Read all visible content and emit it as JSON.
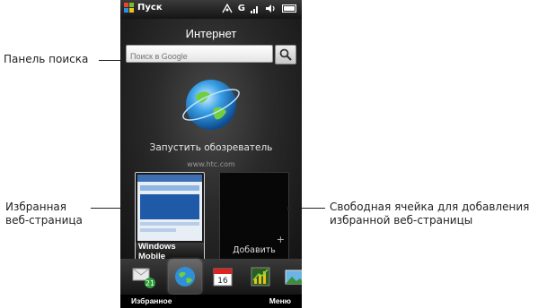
{
  "status_bar": {
    "start_label": "Пуск",
    "network": "G",
    "signal_icon": "signal-icon",
    "sound_icon": "speaker-icon",
    "battery_icon": "battery-icon"
  },
  "internet_tab": {
    "title": "Интернет",
    "search_placeholder": "Поиск в Google",
    "launch_browser_label": "Запустить обозреватель",
    "home_url": "www.htc.com",
    "favorite_tile": {
      "label": "Windows Mobile"
    },
    "empty_tile": {
      "label": "Добавить",
      "plus": "+"
    }
  },
  "dock": {
    "items": [
      {
        "icon": "messaging-icon",
        "badge": "21"
      },
      {
        "icon": "internet-globe-icon",
        "active": true
      },
      {
        "icon": "calendar-icon",
        "day": "16"
      },
      {
        "icon": "stocks-icon"
      },
      {
        "icon": "photos-icon"
      }
    ]
  },
  "softkeys": {
    "left": "Избранное",
    "right": "Меню"
  },
  "callouts": {
    "search_panel": "Панель поиска",
    "favorite_page_line1": "Избранная",
    "favorite_page_line2": "веб-страница",
    "free_cell_line1": "Свободная ячейка для добавления",
    "free_cell_line2": "избранной веб-страницы"
  }
}
